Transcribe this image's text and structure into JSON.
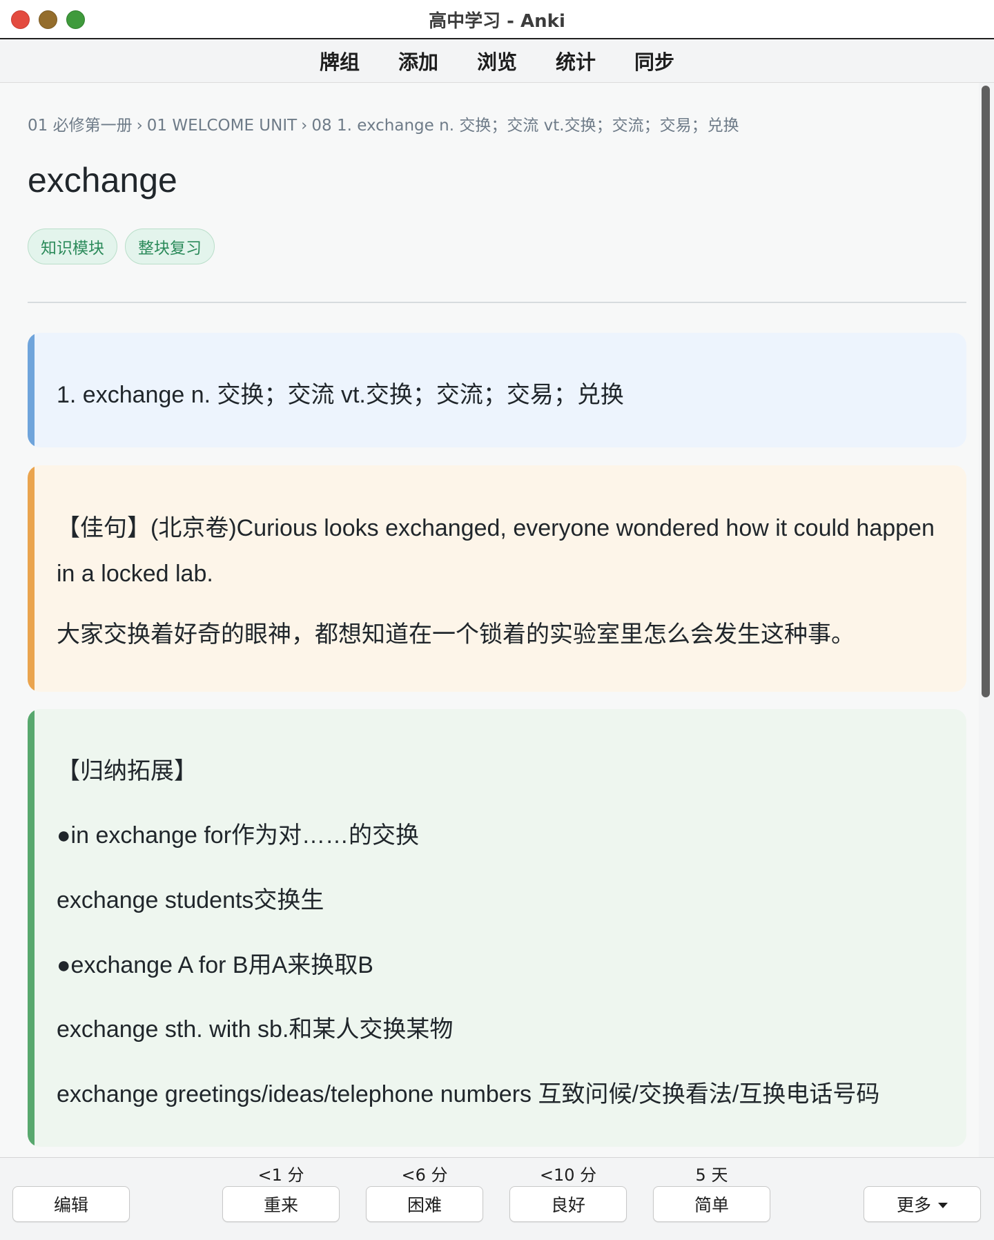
{
  "window": {
    "title": "高中学习 - Anki"
  },
  "toolbar": {
    "items": [
      "牌组",
      "添加",
      "浏览",
      "统计",
      "同步"
    ]
  },
  "breadcrumb": {
    "parts": [
      "01 必修第一册",
      "01 WELCOME UNIT",
      "08 1.   exchange n.   交换；交流 vt.交换；交流；交易；兑换"
    ],
    "separator": "›"
  },
  "card": {
    "word": "exchange",
    "tags": [
      "知识模块",
      "整块复习"
    ],
    "definition": "1.   exchange n.   交换；交流 vt.交换；交流；交易；兑换",
    "example_en": "【佳句】(北京卷)Curious looks exchanged, everyone wondered how it could happen in a locked lab.",
    "example_cn": "大家交换着好奇的眼神，都想知道在一个锁着的实验室里怎么会发生这种事。",
    "expansion": [
      "【归纳拓展】",
      "●in exchange for作为对……的交换",
      "exchange students交换生",
      "●exchange A for B用A来换取B",
      "exchange sth. with sb.和某人交换某物",
      "exchange greetings/ideas/telephone numbers 互致问候/交换看法/互换电话号码"
    ]
  },
  "answer_bar": {
    "edit_label": "编辑",
    "more_label": "更多",
    "buttons": [
      {
        "interval": "<1 分",
        "label": "重来"
      },
      {
        "interval": "<6 分",
        "label": "困难"
      },
      {
        "interval": "<10 分",
        "label": "良好"
      },
      {
        "interval": "5 天",
        "label": "简单"
      }
    ]
  },
  "colors": {
    "definition_accent": "#6fa4db",
    "example_accent": "#eaa44e",
    "expansion_accent": "#58a86e",
    "tag_text": "#2b8a5a"
  }
}
